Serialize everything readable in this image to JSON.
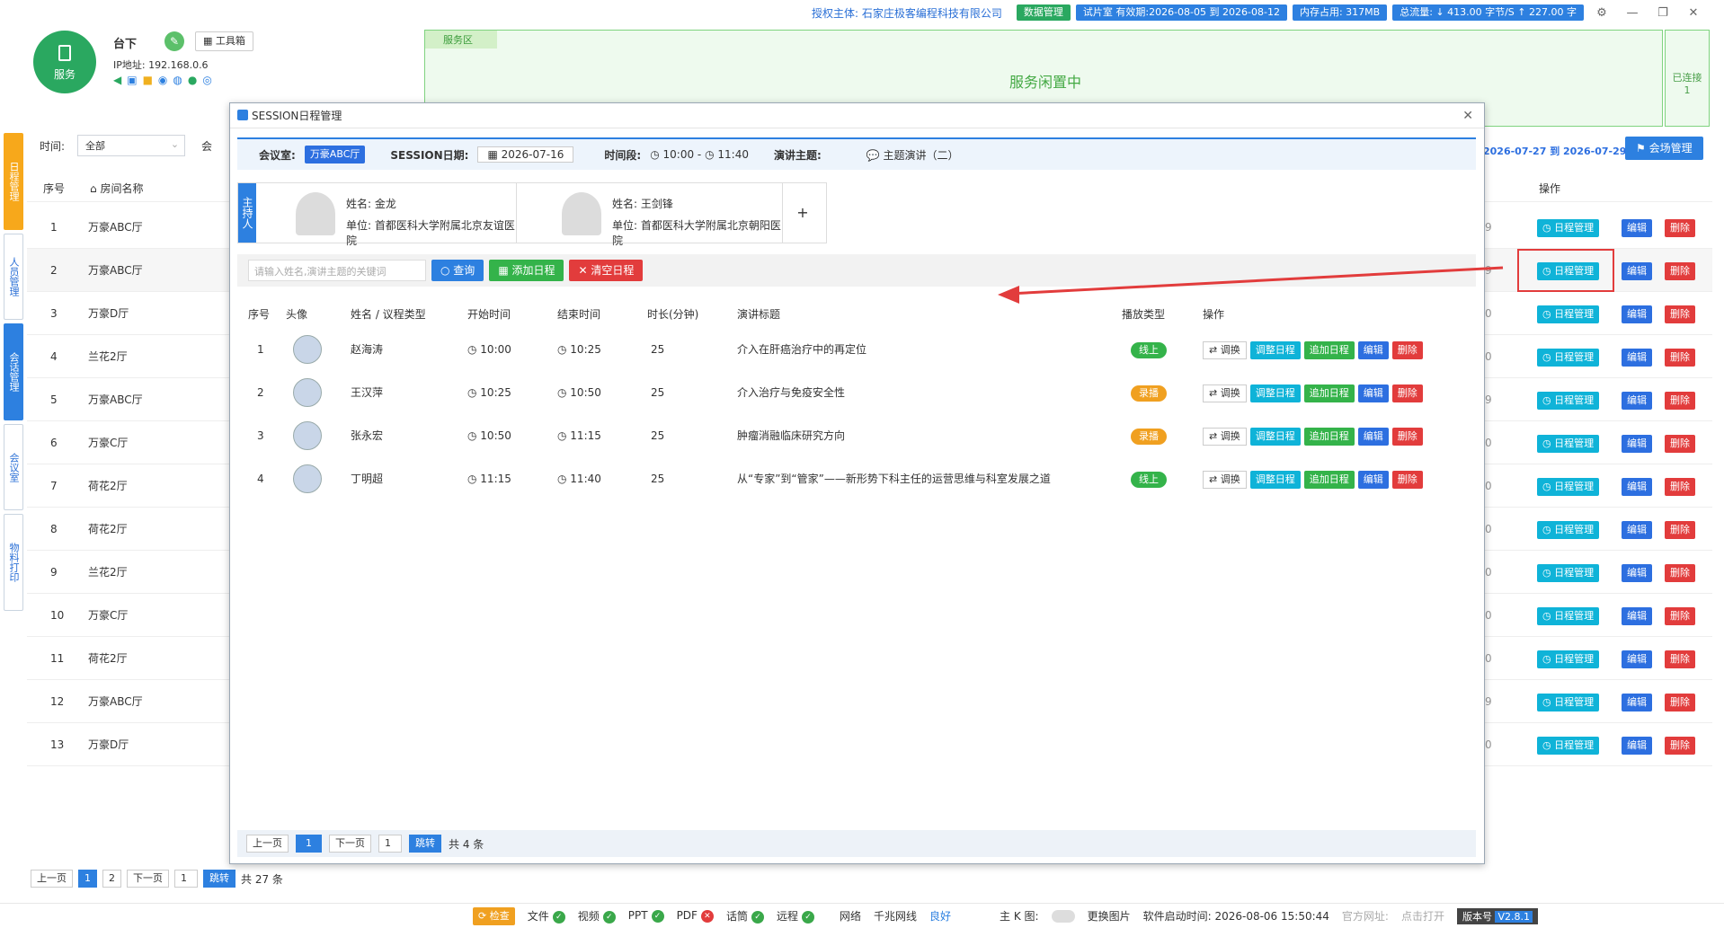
{
  "topbar": {
    "auth_text": "授权主体: 石家庄极客编程科技有限公司",
    "data_mgmt": "数据管理",
    "trial": "试片室 有效期:2026-08-05 到 2026-08-12",
    "memory": "内存占用: 317MB",
    "traffic": "总流量: ↓ 413.00 字节/S  ↑ 227.00 字",
    "colors": {
      "green": "#2aa860",
      "blue": "#2d80e0"
    }
  },
  "header": {
    "logo_label": "服务",
    "user": "台下",
    "toolbox": "工具箱",
    "ip": "IP地址: 192.168.0.6"
  },
  "service": {
    "area_label": "服务区",
    "status": "服务闲置中",
    "connected_label": "已连接",
    "connected_count": "1"
  },
  "leftnav": [
    "日程管理",
    "人员管理",
    "会话管理",
    "会议室",
    "物料打印"
  ],
  "filter": {
    "time_label": "时间:",
    "time_value": "全部",
    "room_label": "会",
    "date_range": "2026-07-27 到 2026-07-29 )",
    "venue_btn": "会场管理"
  },
  "main_table": {
    "headers": [
      "序号",
      "房间名称",
      "操作"
    ],
    "rows": [
      {
        "no": "1",
        "room": "万豪ABC厅",
        "tail": "9"
      },
      {
        "no": "2",
        "room": "万豪ABC厅",
        "tail": "9"
      },
      {
        "no": "3",
        "room": "万豪D厅",
        "tail": "0"
      },
      {
        "no": "4",
        "room": "兰花2厅",
        "tail": "0"
      },
      {
        "no": "5",
        "room": "万豪ABC厅",
        "tail": "9"
      },
      {
        "no": "6",
        "room": "万豪C厅",
        "tail": "0"
      },
      {
        "no": "7",
        "room": "荷花2厅",
        "tail": "0"
      },
      {
        "no": "8",
        "room": "荷花2厅",
        "tail": "0"
      },
      {
        "no": "9",
        "room": "兰花2厅",
        "tail": "0"
      },
      {
        "no": "10",
        "room": "万豪C厅",
        "tail": "0"
      },
      {
        "no": "11",
        "room": "荷花2厅",
        "tail": "0"
      },
      {
        "no": "12",
        "room": "万豪ABC厅",
        "tail": "9"
      },
      {
        "no": "13",
        "room": "万豪D厅",
        "tail": "0"
      }
    ],
    "btn_schedule": "日程管理",
    "btn_edit": "编辑",
    "btn_delete": "删除"
  },
  "main_pager": {
    "prev": "上一页",
    "p1": "1",
    "p2": "2",
    "next": "下一页",
    "goto_value": "1",
    "goto": "跳转",
    "total": "共 27 条"
  },
  "statusbar": {
    "check": "检查",
    "file": "文件",
    "video": "视频",
    "ppt": "PPT",
    "pdf": "PDF",
    "mic": "话筒",
    "remote": "远程",
    "network": "网络",
    "network_type": "千兆网线",
    "network_state": "良好",
    "main_k": "主 K 图:",
    "change_img": "更换图片",
    "start_time": "软件启动时间: 2026-08-06 15:50:44",
    "website": "官方网址:",
    "open": "点击打开",
    "version_label": "版本号",
    "version": "V2.8.1"
  },
  "modal": {
    "title": "SESSION日程管理",
    "room_label": "会议室:",
    "room_value": "万豪ABC厅",
    "date_label": "SESSION日期:",
    "date_value": "2026-07-16",
    "period_label": "时间段:",
    "period_start": "10:00",
    "period_sep": "-",
    "period_end": "11:40",
    "topic_label": "演讲主题:",
    "topic_value": "主题演讲（二）",
    "host_tag": "主持人",
    "hosts": [
      {
        "name": "姓名:  金龙",
        "unit": "单位:  首都医科大学附属北京友谊医院"
      },
      {
        "name": "姓名:  王剑锋",
        "unit": "单位:  首都医科大学附属北京朝阳医院"
      }
    ],
    "add": "+",
    "search_placeholder": "请输入姓名,演讲主题的关键词",
    "btn_query": "查询",
    "btn_add": "添加日程",
    "btn_clear": "清空日程",
    "headers": [
      "序号",
      "头像",
      "姓名 / 议程类型",
      "开始时间",
      "结束时间",
      "时长(分钟)",
      "演讲标题",
      "播放类型",
      "操作"
    ],
    "rows": [
      {
        "no": "1",
        "name": "赵海涛",
        "start": "10:00",
        "end": "10:25",
        "dur": "25",
        "title": "介入在肝癌治疗中的再定位",
        "play": "线上",
        "play_color": "#34b34a"
      },
      {
        "no": "2",
        "name": "王汉萍",
        "start": "10:25",
        "end": "10:50",
        "dur": "25",
        "title": "介入治疗与免疫安全性",
        "play": "录播",
        "play_color": "#f0a020"
      },
      {
        "no": "3",
        "name": "张永宏",
        "start": "10:50",
        "end": "11:15",
        "dur": "25",
        "title": "肿瘤消融临床研究方向",
        "play": "录播",
        "play_color": "#f0a020"
      },
      {
        "no": "4",
        "name": "丁明超",
        "start": "11:15",
        "end": "11:40",
        "dur": "25",
        "title": "从“专家”到“管家”——新形势下科主任的运营思维与科室发展之道",
        "play": "线上",
        "play_color": "#34b34a"
      }
    ],
    "op_swap": "调换",
    "op_adjust": "调整日程",
    "op_append": "追加日程",
    "op_edit": "编辑",
    "op_delete": "删除",
    "pager": {
      "prev": "上一页",
      "p1": "1",
      "next": "下一页",
      "goto_value": "1",
      "goto": "跳转",
      "total": "共 4 条"
    }
  }
}
